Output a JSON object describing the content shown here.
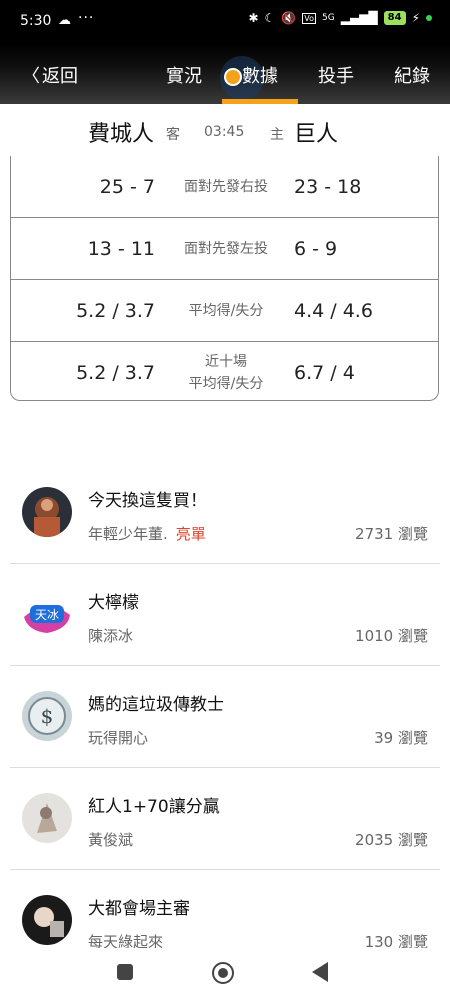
{
  "status_bar": {
    "time": "5:30",
    "icons": [
      "cloud-icon",
      "more-dots-icon",
      "bluetooth-icon",
      "moon-icon",
      "mute-icon",
      "volte-icon",
      "5g-icon",
      "signal-icon",
      "battery-icon"
    ],
    "battery": "84"
  },
  "nav": {
    "back_label": "返回",
    "tabs": [
      {
        "label": "實況"
      },
      {
        "label": "數據",
        "active": true
      },
      {
        "label": "投手"
      },
      {
        "label": "紀錄"
      }
    ],
    "accent": "#f5a21b"
  },
  "matchup": {
    "away_team": "費城人",
    "away_tag": "客",
    "time": "03:45",
    "home_tag": "主",
    "home_team": "巨人"
  },
  "stats": [
    {
      "away": "25 - 7",
      "label": "面對先發右投",
      "home": "23 - 18"
    },
    {
      "away": "13 - 11",
      "label": "面對先發左投",
      "home": "6 - 9"
    },
    {
      "away": "5.2 / 3.7",
      "label": "平均得/失分",
      "home": "4.4 / 4.6"
    },
    {
      "away": "5.2 / 3.7",
      "label": "近十場\n平均得/失分",
      "home": "6.7 / 4"
    }
  ],
  "posts": [
    {
      "title": "今天換這隻買！",
      "author": "年輕少年董.",
      "tag": "亮單",
      "views": "2731 瀏覽"
    },
    {
      "title": "大檸檬",
      "author": "陳添冰",
      "tag": "",
      "views": "1010 瀏覽"
    },
    {
      "title": "媽的這垃圾傳教士",
      "author": "玩得開心",
      "tag": "",
      "views": "39 瀏覽"
    },
    {
      "title": "紅人1+70讓分贏",
      "author": "黃俊斌",
      "tag": "",
      "views": "2035 瀏覽"
    },
    {
      "title": "大都會場主審",
      "author": "每天綠起來",
      "tag": "",
      "views": "130 瀏覽"
    }
  ],
  "colors": {
    "tag_red": "#e0442c",
    "text_gray": "#666666"
  }
}
